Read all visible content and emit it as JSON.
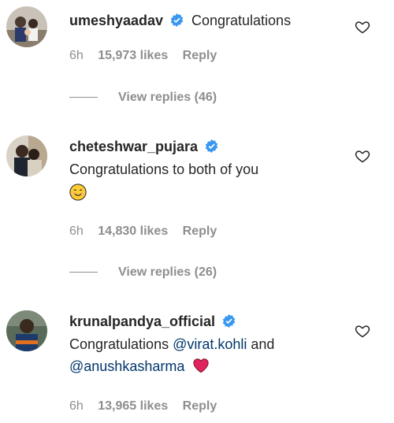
{
  "comments": [
    {
      "username": "umeshyaadav",
      "text": "Congratulations",
      "time": "6h",
      "likes": "15,973 likes",
      "reply": "Reply",
      "view_replies": "View replies (46)"
    },
    {
      "username": "cheteshwar_pujara",
      "text": "Congratulations to both of you",
      "time": "6h",
      "likes": "14,830 likes",
      "reply": "Reply",
      "view_replies": "View replies (26)"
    },
    {
      "username": "krunalpandya_official",
      "text_prefix": "Congratulations ",
      "mention1": "@virat.kohli",
      "text_mid": " and",
      "mention2": "@anushkasharma",
      "time": "6h",
      "likes": "13,965 likes",
      "reply": "Reply"
    }
  ],
  "colors": {
    "verified": "#3897f0",
    "meta": "#8e8e8e",
    "mention": "#00376b",
    "heart_emoji": "#e0245e"
  }
}
